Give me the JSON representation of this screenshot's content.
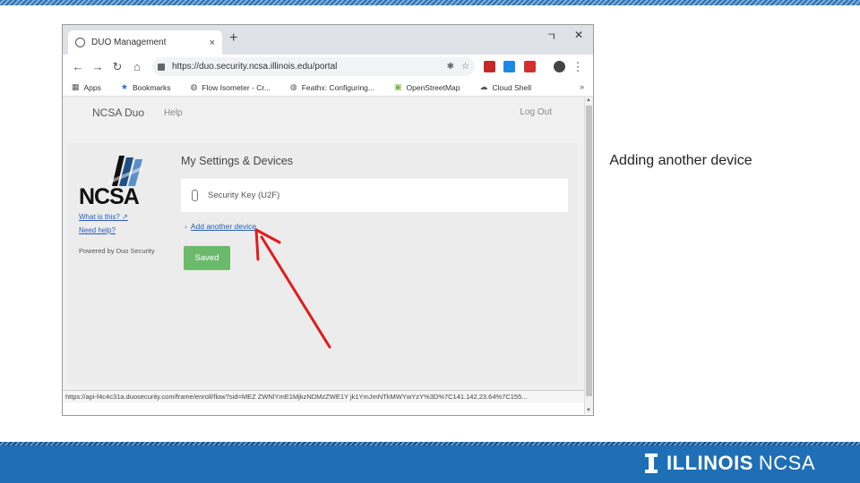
{
  "slide": {
    "caption": "Adding another device",
    "brand_illinois": "ILLINOIS",
    "brand_ncsa": "NCSA"
  },
  "browser": {
    "tab_title": "DUO Management",
    "tab_close": "×",
    "new_tab": "+",
    "minimize": "ㄱ",
    "close": "✕",
    "url": "https://duo.security.ncsa.illinois.edu/portal",
    "bookmarks": [
      {
        "label": "Apps",
        "icon": "grid-icon"
      },
      {
        "label": "Bookmarks",
        "icon": "star-icon"
      },
      {
        "label": "Flow Isometer - Cr...",
        "icon": "globe-icon"
      },
      {
        "label": "Feathx: Configuring...",
        "icon": "globe-icon"
      },
      {
        "label": "OpenStreetMap",
        "icon": "map-icon"
      },
      {
        "label": "Cloud Shell",
        "icon": "cloud-icon"
      }
    ],
    "bookmarks_more": "»",
    "status_url": "https://api-f4c4c31a.duosecurity.com/frame/enroll/flow?sid=MEZ ZWNlYmE1MjkzNDMzZWE1Y jk1YmJmNTkMWYwYzY%3D%7C141.142.23.64%7C155..."
  },
  "duo": {
    "brand": "NCSA Duo",
    "help": "Help",
    "logout": "Log Out",
    "logo_text": "NCSA",
    "what_is_this": "What is this? ↗",
    "need_help": "Need help?",
    "powered_by": "Powered by Duo Security",
    "settings_title": "My Settings & Devices",
    "device_label": "Security Key (U2F)",
    "add_device": "Add another device",
    "saved_button": "Saved"
  }
}
